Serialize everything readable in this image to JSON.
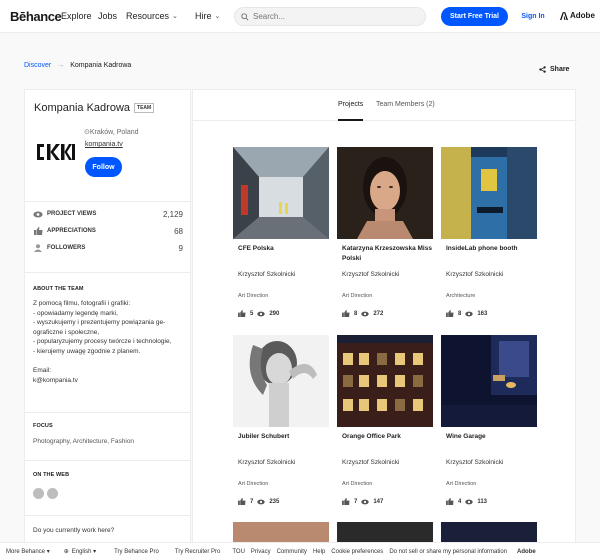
{
  "header": {
    "logo": "Bēhance",
    "nav": [
      "Explore",
      "Jobs",
      "Resources",
      "Hire"
    ],
    "search_placeholder": "Search...",
    "trial_label": "Start Free Trial",
    "signin_label": "Sign In",
    "adobe_label": "Adobe"
  },
  "breadcrumb": {
    "discover": "Discover",
    "sep": "→",
    "current": "Kompania Kadrowa"
  },
  "share_label": "Share",
  "team": {
    "name": "Kompania Kadrowa",
    "badge": "TEAM",
    "logo_text": "[K]",
    "location": "Kraków, Poland",
    "website": "kompania.tv",
    "follow_label": "Follow"
  },
  "stats": [
    {
      "label": "PROJECT VIEWS",
      "value": "2,129",
      "icon": "eye-icon"
    },
    {
      "label": "APPRECIATIONS",
      "value": "68",
      "icon": "thumbs-up-icon"
    },
    {
      "label": "FOLLOWERS",
      "value": "9",
      "icon": "person-icon"
    }
  ],
  "about": {
    "heading": "ABOUT THE TEAM",
    "lines": [
      "Z pomocą filmu, fotografii i grafiki:",
      "- opowiadamy legendę marki,",
      "- wyszukujemy i prezentujemy powiązania ge-",
      "ograficzne i społeczne,",
      "- popularyzujemy procesy twórcze i technologie,",
      "- kierujemy uwagę zgodnie z planem."
    ],
    "email_label": "Email:",
    "email": "k@kompania.tv"
  },
  "focus": {
    "heading": "FOCUS",
    "text": "Photography, Architecture, Fashion"
  },
  "web": {
    "heading": "ON THE WEB"
  },
  "work_question": "Do you currently work here?",
  "tabs": {
    "projects": "Projects",
    "members": "Team Members (2)"
  },
  "projects": [
    {
      "title": "CFE Polska",
      "owner": "Krzysztof Szkolnicki",
      "field": "Art Direction",
      "likes": "5",
      "views": "290"
    },
    {
      "title": "Katarzyna Krzeszowska Miss Polski",
      "owner": "Krzysztof Szkolnicki",
      "field": "Art Direction",
      "likes": "8",
      "views": "272"
    },
    {
      "title": "InsideLab phone booth",
      "owner": "Krzysztof Szkolnicki",
      "field": "Architecture",
      "likes": "8",
      "views": "163"
    },
    {
      "title": "Jubiler Schubert",
      "owner": "Krzysztof Szkolnicki",
      "field": "Art Direction",
      "likes": "7",
      "views": "235"
    },
    {
      "title": "Orange Office Park",
      "owner": "Krzysztof Szkolnicki",
      "field": "Art Direction",
      "likes": "7",
      "views": "147"
    },
    {
      "title": "Wine Garage",
      "owner": "Krzysztof Szkolnicki",
      "field": "Art Direction",
      "likes": "4",
      "views": "113"
    }
  ],
  "footer": [
    "More Behance ▾",
    "English ▾",
    "Try Behance Pro",
    "Try Recruiter Pro",
    "TOU",
    "Privacy",
    "Community",
    "Help",
    "Cookie preferences",
    "Do not sell or share my personal information"
  ],
  "colors": {
    "accent": "#0057ff"
  }
}
